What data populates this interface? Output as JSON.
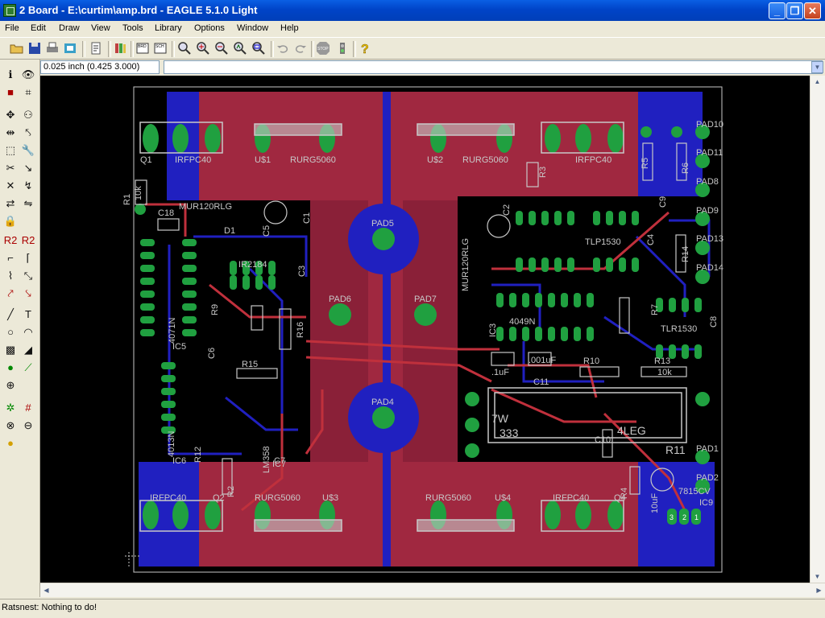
{
  "window": {
    "title": "2 Board - E:\\curtim\\amp.brd - EAGLE 5.1.0 Light"
  },
  "menu": [
    "File",
    "Edit",
    "Draw",
    "View",
    "Tools",
    "Library",
    "Options",
    "Window",
    "Help"
  ],
  "toolbar_icons": [
    "open-icon",
    "save-icon",
    "print-icon",
    "cam-icon",
    "script-icon",
    "library-icon",
    "board-icon",
    "schematic-icon",
    "zoom-fit-icon",
    "zoom-in-icon",
    "zoom-out-icon",
    "zoom-redraw-icon",
    "zoom-select-icon",
    "undo-icon",
    "redo-icon",
    "stop-icon",
    "go-icon",
    "help-icon"
  ],
  "coordinate": "0.025 inch (0.425 3.000)",
  "command_text": "",
  "status": "Ratsnest: Nothing to do!",
  "colors": {
    "top_copper": "#c0303c",
    "bottom_copper": "#2020c0",
    "pad": "#20a040",
    "silk": "#c8c8c8",
    "canvas": "#000000"
  },
  "components": [
    "Q1",
    "IRFPC40",
    "U$1",
    "RURG5060",
    "U$2",
    "RURG5060",
    "R3",
    "IRFPC40",
    "R1",
    "10k",
    "PAD10",
    "PAD11",
    "PAD8",
    "PAD9",
    "PAD13",
    "PAD14",
    "R5",
    "R6",
    "C18",
    "MUR120RLG",
    "D1",
    "C5",
    "C1",
    "C3",
    "PAD5",
    "IR2184",
    "PAD6",
    "PAD7",
    "MUR120RLG",
    "4049N",
    "IC3",
    "TLP1530",
    "C4",
    "TLR1530",
    "C8",
    "R14",
    "4071N",
    "IC5",
    "R16",
    "R15",
    "C6",
    "C2",
    "C11",
    "R10",
    "R13",
    "10k",
    ".001uF",
    ".1uF",
    "PAD4",
    "7W",
    "333",
    "4LEG",
    "R11",
    "C10",
    "4013N",
    "IC6",
    "LM358",
    "IC7",
    "R12",
    "R2",
    "IRFPC40",
    "U$3",
    "RURG5060",
    "Q2",
    "RURG5060",
    "U$4",
    "IRFPC40",
    "Q4",
    "PAD1",
    "PAD2",
    "7815CV",
    "IC9",
    "10uF",
    "3",
    "2",
    "1",
    "C7",
    "R4",
    "R9",
    "R7",
    "C9"
  ]
}
